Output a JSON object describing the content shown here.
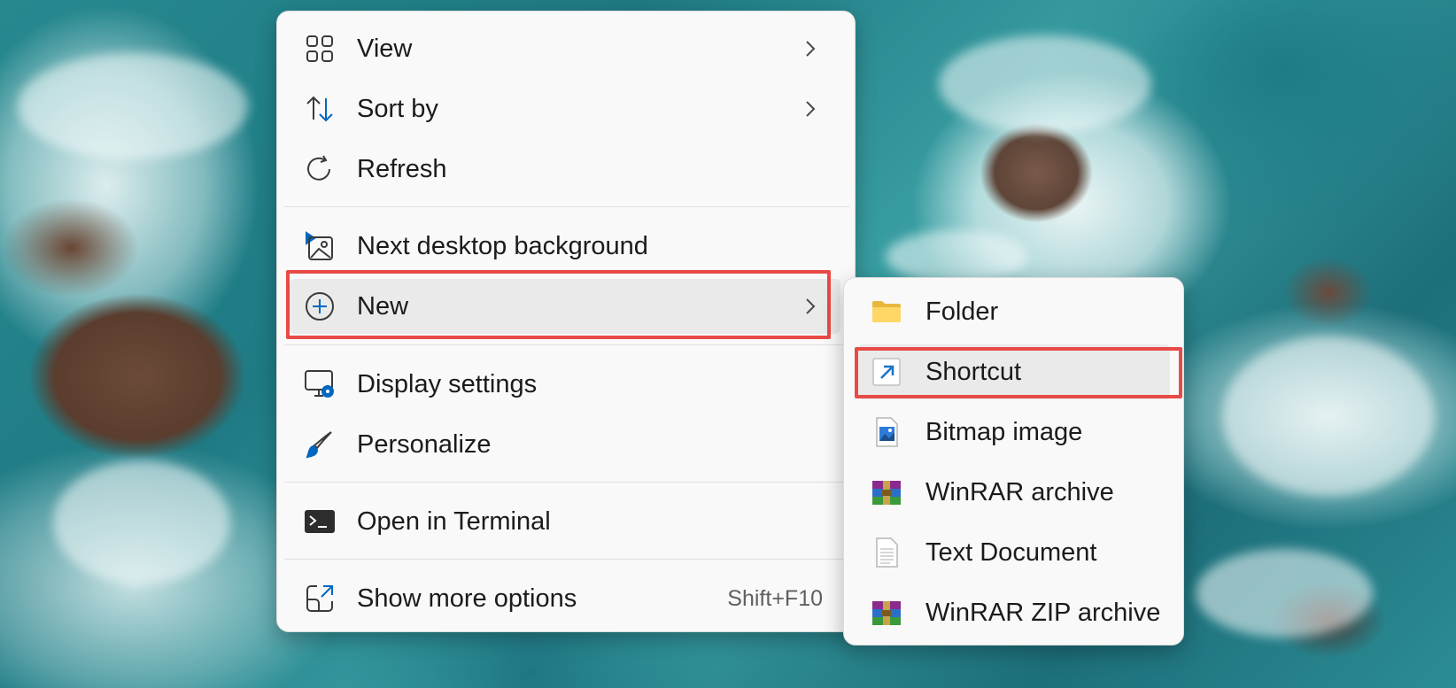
{
  "context_menu": {
    "items": [
      {
        "label": "View",
        "icon": "view-grid-icon",
        "has_submenu": true
      },
      {
        "label": "Sort by",
        "icon": "sort-icon",
        "has_submenu": true
      },
      {
        "label": "Refresh",
        "icon": "refresh-icon",
        "has_submenu": false
      },
      {
        "label": "Next desktop background",
        "icon": "next-background-icon",
        "has_submenu": false
      },
      {
        "label": "New",
        "icon": "new-plus-icon",
        "has_submenu": true,
        "highlighted": true
      },
      {
        "label": "Display settings",
        "icon": "display-settings-icon",
        "has_submenu": false
      },
      {
        "label": "Personalize",
        "icon": "paintbrush-icon",
        "has_submenu": false
      },
      {
        "label": "Open in Terminal",
        "icon": "terminal-icon",
        "has_submenu": false
      },
      {
        "label": "Show more options",
        "icon": "more-options-icon",
        "shortcut": "Shift+F10"
      }
    ]
  },
  "new_submenu": {
    "items": [
      {
        "label": "Folder",
        "icon": "folder-icon"
      },
      {
        "label": "Shortcut",
        "icon": "shortcut-icon",
        "highlighted": true
      },
      {
        "label": "Bitmap image",
        "icon": "bitmap-image-icon"
      },
      {
        "label": "WinRAR archive",
        "icon": "winrar-icon"
      },
      {
        "label": "Text Document",
        "icon": "text-document-icon"
      },
      {
        "label": "WinRAR ZIP archive",
        "icon": "winrar-zip-icon"
      }
    ]
  },
  "colors": {
    "menu_background": "#f9f9f9",
    "highlight_background": "#eaeaea",
    "annotation_red": "#e84a45",
    "accent_blue": "#0067c0"
  }
}
